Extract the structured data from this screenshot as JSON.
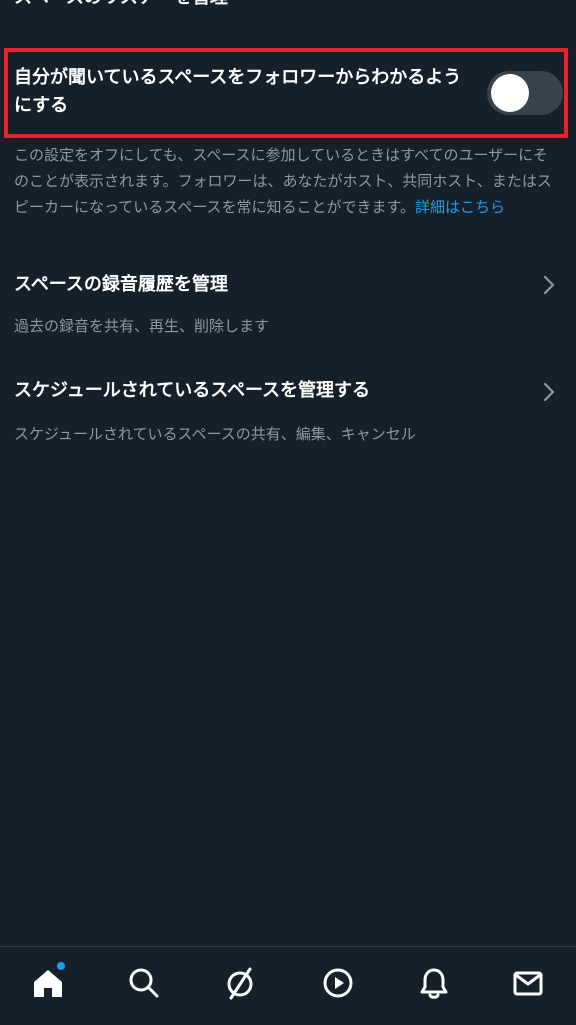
{
  "top_partial_text": "スペースのリスナーを管理",
  "listening_toggle": {
    "label": "自分が聞いているスペースをフォロワーからわかるようにする",
    "enabled": false
  },
  "description": {
    "text": "この設定をオフにしても、スペースに参加しているときはすべてのユーザーにそのことが表示されます。フォロワーは、あなたがホスト、共同ホスト、またはスピーカーになっているスペースを常に知ることができます。",
    "link_label": "詳細はこちら"
  },
  "settings_rows": [
    {
      "title": "スペースの録音履歴を管理",
      "subtitle": "過去の録音を共有、再生、削除します"
    },
    {
      "title": "スケジュールされているスペースを管理する",
      "subtitle": "スケジュールされているスペースの共有、編集、キャンセル"
    }
  ],
  "bottom_nav": {
    "items": [
      "home-icon",
      "search-icon",
      "communities-icon",
      "video-icon",
      "notifications-icon",
      "messages-icon"
    ],
    "home_has_badge": true
  },
  "colors": {
    "background": "#15202b",
    "accent": "#1d9bf0",
    "highlight": "#e8212c",
    "secondary_text": "#8b98a5",
    "toggle_off": "#38444d"
  }
}
